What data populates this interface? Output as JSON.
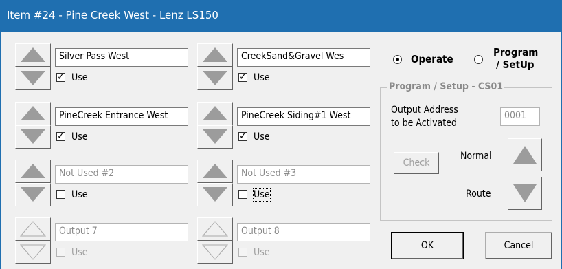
{
  "window": {
    "title": "Item #24 - Pine Creek West - Lenz LS150"
  },
  "outputs": [
    {
      "name": "Silver Pass West",
      "use_label": "Use",
      "checked": "✓"
    },
    {
      "name": "CreekSand&Gravel Wes",
      "use_label": "Use",
      "checked": "✓"
    },
    {
      "name": "PineCreek Entrance West",
      "use_label": "Use",
      "checked": "✓"
    },
    {
      "name": "PineCreek Siding#1 West",
      "use_label": "Use",
      "checked": "✓"
    },
    {
      "name": "Not Used #2",
      "use_label": "Use",
      "checked": ""
    },
    {
      "name": "Not Used #3",
      "use_label": "Use",
      "checked": ""
    },
    {
      "name": "Output 7",
      "use_label": "Use",
      "checked": ""
    },
    {
      "name": "Output 8",
      "use_label": "Use",
      "checked": ""
    }
  ],
  "mode": {
    "operate_label": "Operate",
    "program_label_line1": "Program",
    "program_label_line2": "/ SetUp",
    "selected": "Operate"
  },
  "program_setup": {
    "group_title": "Program / Setup  -  CS01",
    "output_address_line1": "Output Address",
    "output_address_line2": "to be Activated",
    "output_address_value": "0001",
    "check_label": "Check",
    "normal_label": "Normal",
    "route_label": "Route"
  },
  "buttons": {
    "ok_label": "OK",
    "cancel_label": "Cancel"
  }
}
